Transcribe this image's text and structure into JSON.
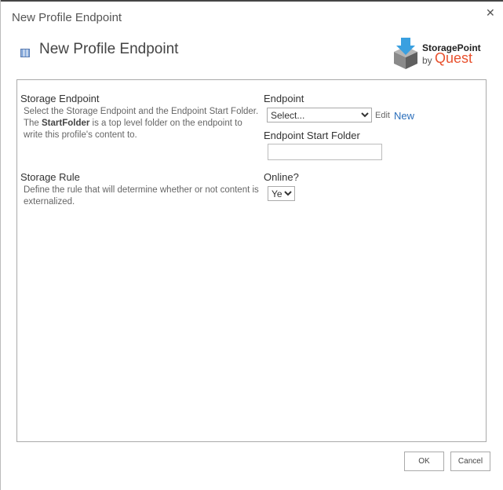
{
  "dialog": {
    "title": "New Profile Endpoint",
    "close_icon": "close-icon"
  },
  "header": {
    "title": "New Profile Endpoint",
    "logo": {
      "line1": "StoragePoint",
      "by": "by",
      "brand": "Quest"
    }
  },
  "sections": [
    {
      "title": "Storage Endpoint",
      "desc_pre": "Select the Storage Endpoint and the Endpoint Start Folder. The ",
      "desc_bold": "StartFolder",
      "desc_post": " is a top level folder on the endpoint to write this profile's content to."
    },
    {
      "title": "Storage Rule",
      "desc": "Define the rule that will determine whether or not content is externalized."
    }
  ],
  "fields": {
    "endpoint": {
      "label": "Endpoint",
      "value": "Select...",
      "edit": "Edit",
      "new": "New"
    },
    "start_folder": {
      "label": "Endpoint Start Folder",
      "value": ""
    },
    "online": {
      "label": "Online?",
      "value": "Yes"
    }
  },
  "buttons": {
    "ok": "OK",
    "cancel": "Cancel"
  },
  "colors": {
    "link": "#2a6ebb",
    "brand": "#e8512e"
  }
}
